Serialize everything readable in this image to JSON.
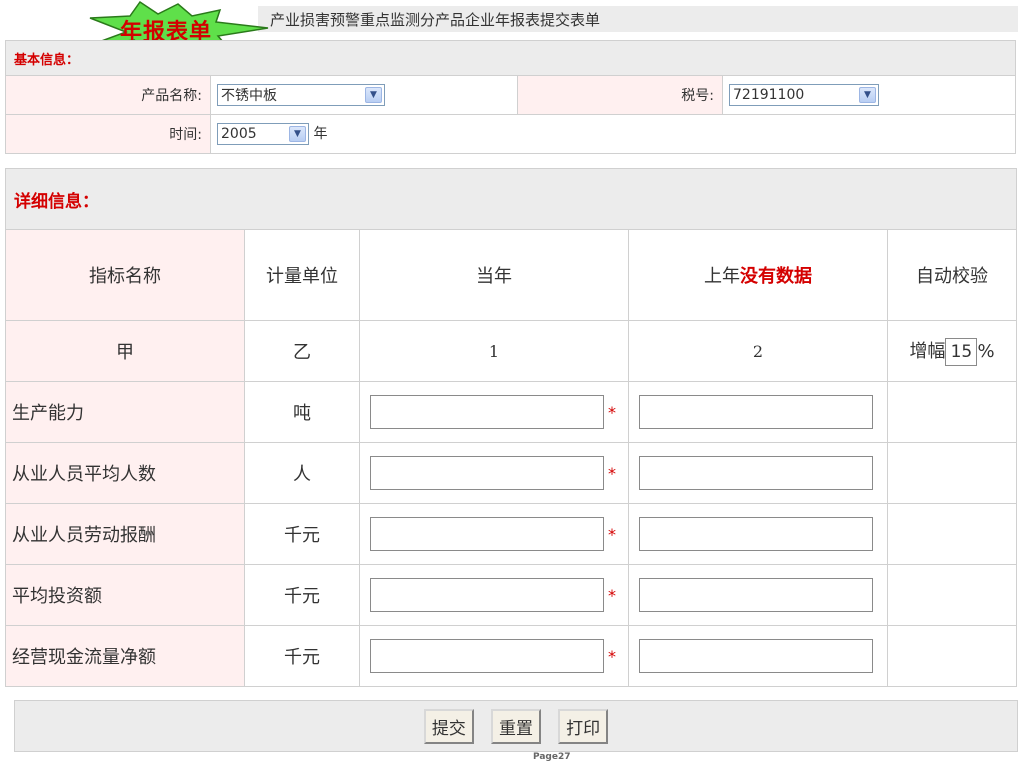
{
  "title": {
    "text": "产业损害预警重点监测分产品企业年报表提交表单",
    "badge": "年报表单"
  },
  "basic": {
    "header": "基本信息：",
    "product_label": "产品名称:",
    "product_value": "不锈中板",
    "tax_label": "税号:",
    "tax_value": "72191100",
    "time_label": "时间:",
    "year_value": "2005",
    "year_unit": "年"
  },
  "detail": {
    "header": "详细信息：",
    "columns": {
      "name": "指标名称",
      "unit": "计量单位",
      "current": "当年",
      "last_prefix": "上年",
      "last_note": "没有数据",
      "check": "自动校验"
    },
    "code_row": {
      "name": "甲",
      "unit": "乙",
      "current": "1",
      "last": "2",
      "increase_label": "增幅",
      "increase_value": "15",
      "percent": "%"
    },
    "rows": [
      {
        "name": "生产能力",
        "unit": "吨"
      },
      {
        "name": "从业人员平均人数",
        "unit": "人"
      },
      {
        "name": "从业人员劳动报酬",
        "unit": "千元"
      },
      {
        "name": "平均投资额",
        "unit": "千元"
      },
      {
        "name": "经营现金流量净额",
        "unit": "千元"
      }
    ],
    "required_mark": "*"
  },
  "buttons": {
    "submit": "提交",
    "reset": "重置",
    "print": "打印"
  },
  "footer": "Page27",
  "colors": {
    "accent": "#d40000",
    "label_bg": "#fff0f0",
    "header_bg": "#ececec"
  }
}
